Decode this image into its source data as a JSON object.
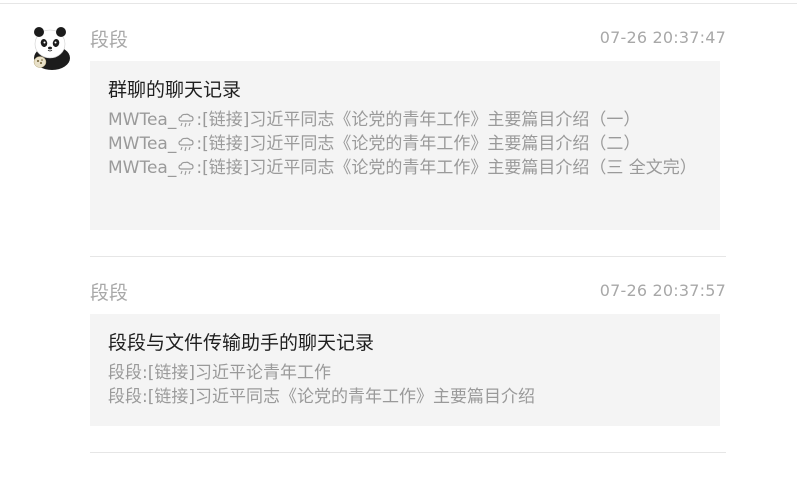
{
  "messages": [
    {
      "sender": "段段",
      "time": "07-26 20:37:47",
      "card": {
        "title": "群聊的聊天记录",
        "lines": [
          {
            "prefix": "MWTea_",
            "suffix": ":[链接]习近平同志《论党的青年工作》主要篇目介绍（一）"
          },
          {
            "prefix": "MWTea_",
            "suffix": ":[链接]习近平同志《论党的青年工作》主要篇目介绍（二）"
          },
          {
            "prefix": "MWTea_",
            "suffix": ":[链接]习近平同志《论党的青年工作》主要篇目介绍（三 全文完）"
          }
        ]
      }
    },
    {
      "sender": "段段",
      "time": "07-26 20:37:57",
      "card": {
        "title": "段段与文件传输助手的聊天记录",
        "lines": [
          {
            "text": "段段:[链接]习近平论青年工作"
          },
          {
            "text": "段段:[链接]习近平同志《论党的青年工作》主要篇目介绍"
          }
        ]
      }
    }
  ],
  "colors": {
    "sender": "#a8a8a8",
    "time": "#a8a8a8",
    "card_bg": "#f4f4f4",
    "title": "#1f1f1f",
    "line": "#9a9a9a",
    "divider": "#e6e6e6"
  },
  "icons": {
    "avatar": "panda-avatar-icon",
    "inline_emoji": "cloud-rain-emoji-icon"
  }
}
